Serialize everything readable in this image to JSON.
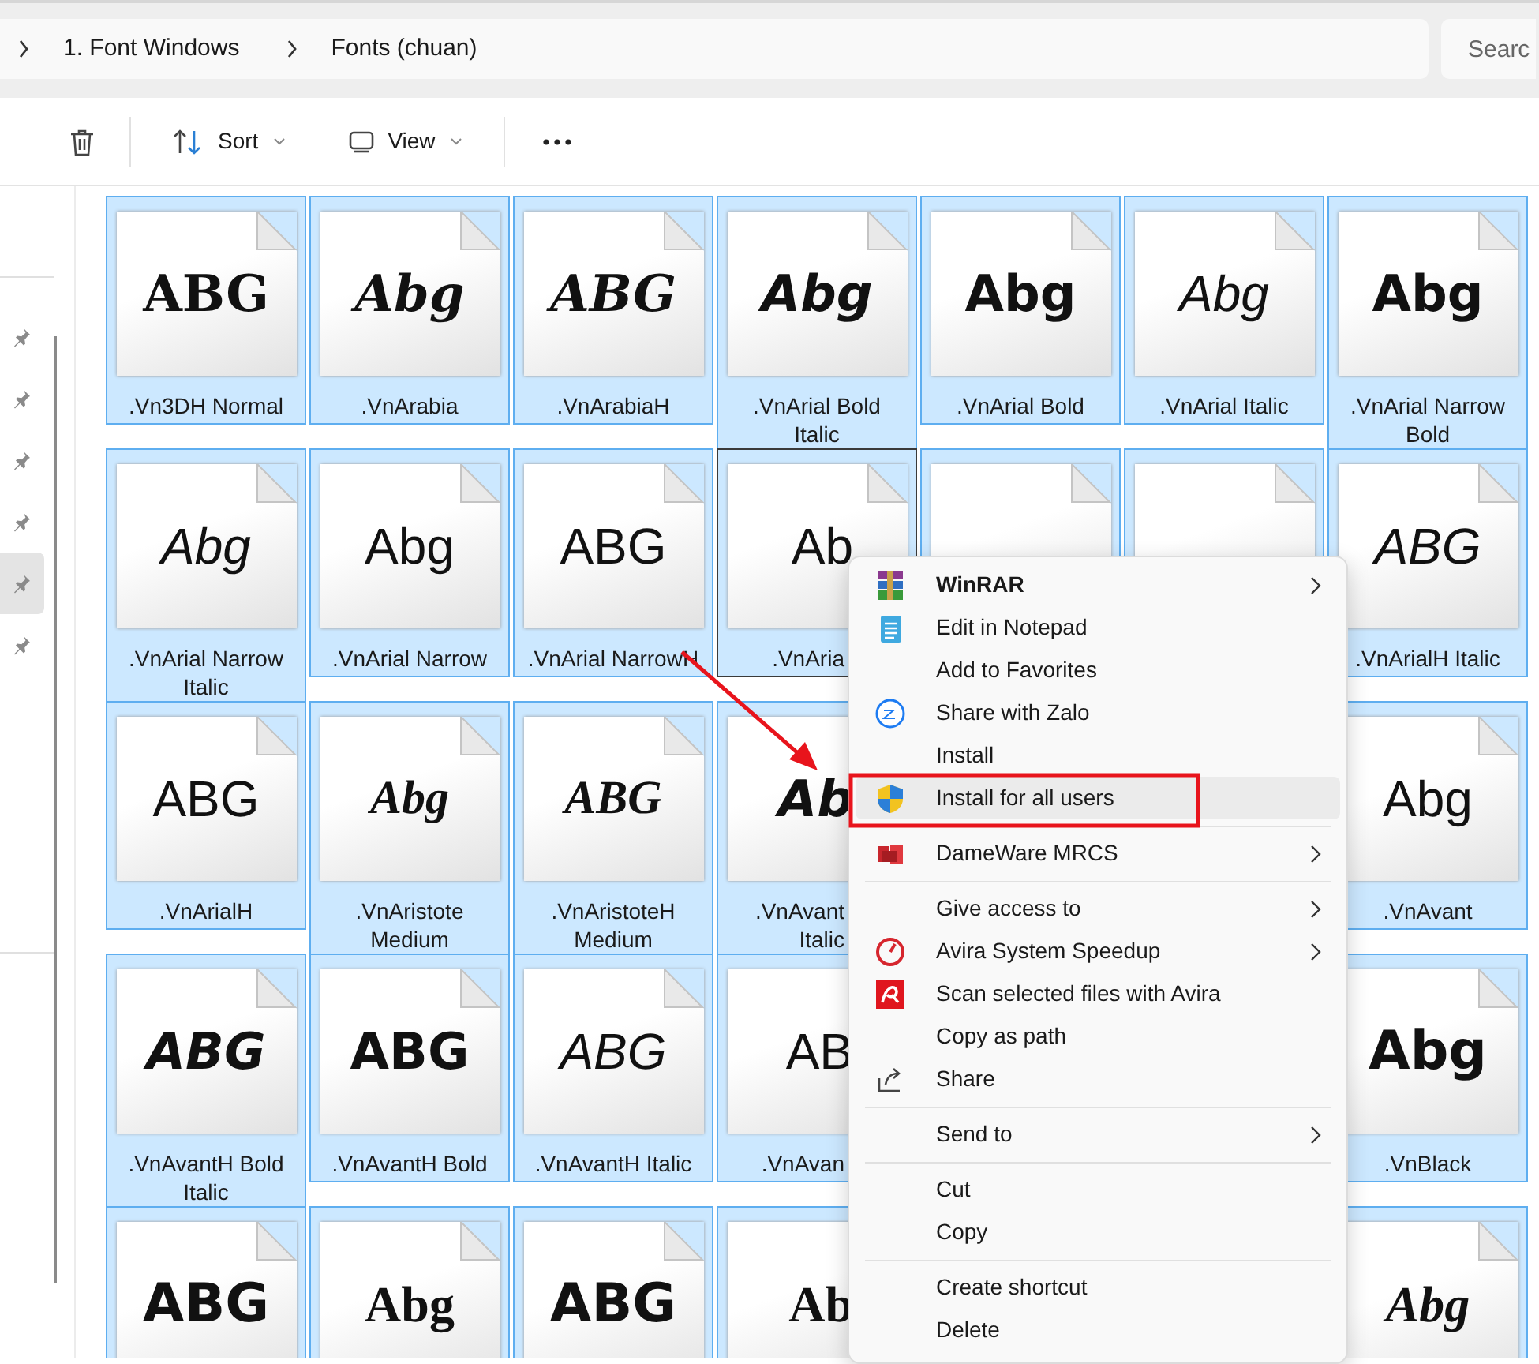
{
  "address_bar": {
    "breadcrumbs": [
      "1. Font Windows",
      "Fonts (chuan)"
    ]
  },
  "search": {
    "placeholder": "Searc"
  },
  "toolbar": [
    {
      "kind": "delete"
    },
    {
      "kind": "sort",
      "label": "Sort"
    },
    {
      "kind": "view",
      "label": "View"
    },
    {
      "kind": "more"
    }
  ],
  "sidebar": {
    "items": [
      {
        "selected": false
      },
      {
        "selected": false
      },
      {
        "selected": false
      },
      {
        "selected": false
      },
      {
        "selected": true
      },
      {
        "selected": false
      }
    ]
  },
  "files": [
    [
      {
        "sample": "ABG",
        "kind": "decorative",
        "label": [
          ".Vn3DH Normal"
        ],
        "selected": true,
        "focused": false
      },
      {
        "sample": "Abg",
        "kind": "arabia",
        "label": [
          ".VnArabia"
        ],
        "selected": true,
        "focused": false
      },
      {
        "sample": "ABG",
        "kind": "arabia",
        "label": [
          ".VnArabiaH"
        ],
        "selected": true,
        "focused": false
      },
      {
        "sample": "Abg",
        "kind": "bold-italic",
        "label": [
          ".VnArial Bold",
          "Italic"
        ],
        "selected": true,
        "focused": false
      },
      {
        "sample": "Abg",
        "kind": "bold",
        "label": [
          ".VnArial Bold"
        ],
        "selected": true,
        "focused": false
      },
      {
        "sample": "Abg",
        "kind": "italic",
        "label": [
          ".VnArial Italic"
        ],
        "selected": true,
        "focused": false
      },
      {
        "sample": "Abg",
        "kind": "bold",
        "label": [
          ".VnArial Narrow",
          "Bold"
        ],
        "selected": true,
        "focused": false
      }
    ],
    [
      {
        "sample": "Abg",
        "kind": "italic",
        "label": [
          ".VnArial Narrow",
          "Italic"
        ],
        "selected": true,
        "focused": false
      },
      {
        "sample": "Abg",
        "kind": "regular",
        "label": [
          ".VnArial Narrow"
        ],
        "selected": true,
        "focused": false
      },
      {
        "sample": "ABG",
        "kind": "regular",
        "label": [
          ".VnArial NarrowH"
        ],
        "selected": true,
        "focused": false
      },
      {
        "sample": "Ab",
        "kind": "regular",
        "label": [
          ".VnAria"
        ],
        "selected": true,
        "focused": true,
        "covered": true
      },
      {
        "selected": true,
        "focused": false,
        "covered": true
      },
      {
        "selected": true,
        "focused": false,
        "covered": true
      },
      {
        "sample": "ABG",
        "kind": "italic",
        "label": [
          ".VnArialH Italic"
        ],
        "selected": true,
        "focused": false
      }
    ],
    [
      {
        "sample": "ABG",
        "kind": "regular",
        "label": [
          ".VnArialH"
        ],
        "selected": true,
        "focused": false
      },
      {
        "sample": "Abg",
        "kind": "script",
        "label": [
          ".VnAristote",
          "Medium"
        ],
        "selected": true,
        "focused": false
      },
      {
        "sample": "ABG",
        "kind": "script",
        "label": [
          ".VnAristoteH",
          "Medium"
        ],
        "selected": true,
        "focused": false
      },
      {
        "sample": "Ab",
        "kind": "bold-italic",
        "label": [
          ".VnAvant",
          "Italic"
        ],
        "selected": true,
        "focused": false,
        "covered": true
      },
      {
        "sample": "Abg",
        "kind": "regular",
        "label": [
          ".VnAvant"
        ],
        "selected": true,
        "focused": false
      }
    ],
    [
      {
        "sample": "ABG",
        "kind": "bold-italic",
        "label": [
          ".VnAvantH Bold",
          "Italic"
        ],
        "selected": true,
        "focused": false
      },
      {
        "sample": "ABG",
        "kind": "bold",
        "label": [
          ".VnAvantH Bold"
        ],
        "selected": true,
        "focused": false
      },
      {
        "sample": "ABG",
        "kind": "italic",
        "label": [
          ".VnAvantH Italic"
        ],
        "selected": true,
        "focused": false
      },
      {
        "sample": "AB",
        "kind": "regular",
        "label": [
          ".VnAvan"
        ],
        "selected": true,
        "focused": false,
        "covered": true
      },
      {
        "sample": "Abg",
        "kind": "black",
        "label": [
          ".VnBlack"
        ],
        "selected": true,
        "focused": false
      }
    ],
    [
      {
        "sample": "ABG",
        "kind": "black",
        "selected": true,
        "focused": false
      },
      {
        "sample": "Abg",
        "kind": "serif-bold",
        "selected": true,
        "focused": false
      },
      {
        "sample": "ABG",
        "kind": "black",
        "selected": true,
        "focused": false
      },
      {
        "sample": "Ab",
        "kind": "serif-bold",
        "selected": true,
        "focused": false,
        "covered": true
      },
      {
        "sample": "Abg",
        "kind": "serif-bold-italic",
        "selected": true,
        "focused": false
      }
    ]
  ],
  "context_menu": {
    "items": [
      {
        "kind": "winrar",
        "label": "WinRAR",
        "bold": true,
        "submenu": true,
        "highlighted": false
      },
      {
        "kind": "notepad",
        "label": "Edit in Notepad",
        "bold": false,
        "submenu": false,
        "highlighted": false
      },
      {
        "kind": "plain",
        "label": "Add to Favorites",
        "bold": false,
        "submenu": false,
        "highlighted": false
      },
      {
        "kind": "zalo",
        "label": "Share with Zalo",
        "bold": false,
        "submenu": false,
        "highlighted": false
      },
      {
        "kind": "plain",
        "label": "Install",
        "bold": false,
        "submenu": false,
        "highlighted": false
      },
      {
        "kind": "shield",
        "label": "Install for all users",
        "bold": false,
        "submenu": false,
        "highlighted": true
      },
      {
        "kind": "separator"
      },
      {
        "kind": "dameware",
        "label": "DameWare MRCS",
        "bold": false,
        "submenu": true,
        "highlighted": false
      },
      {
        "kind": "separator"
      },
      {
        "kind": "plain",
        "label": "Give access to",
        "bold": false,
        "submenu": true,
        "highlighted": false
      },
      {
        "kind": "speedup",
        "label": "Avira System Speedup",
        "bold": false,
        "submenu": true,
        "highlighted": false
      },
      {
        "kind": "avira",
        "label": "Scan selected files with Avira",
        "bold": false,
        "submenu": false,
        "highlighted": false
      },
      {
        "kind": "plain",
        "label": "Copy as path",
        "bold": false,
        "submenu": false,
        "highlighted": false
      },
      {
        "kind": "share",
        "label": "Share",
        "bold": false,
        "submenu": false,
        "highlighted": false
      },
      {
        "kind": "separator"
      },
      {
        "kind": "plain",
        "label": "Send to",
        "bold": false,
        "submenu": true,
        "highlighted": false
      },
      {
        "kind": "separator"
      },
      {
        "kind": "plain",
        "label": "Cut",
        "bold": false,
        "submenu": false,
        "highlighted": false
      },
      {
        "kind": "plain",
        "label": "Copy",
        "bold": false,
        "submenu": false,
        "highlighted": false
      },
      {
        "kind": "separator"
      },
      {
        "kind": "plain",
        "label": "Create shortcut",
        "bold": false,
        "submenu": false,
        "highlighted": false
      },
      {
        "kind": "plain",
        "label": "Delete",
        "bold": false,
        "submenu": false,
        "highlighted": false
      }
    ]
  },
  "annotations": {
    "arrow": true,
    "highlight_box": true
  }
}
